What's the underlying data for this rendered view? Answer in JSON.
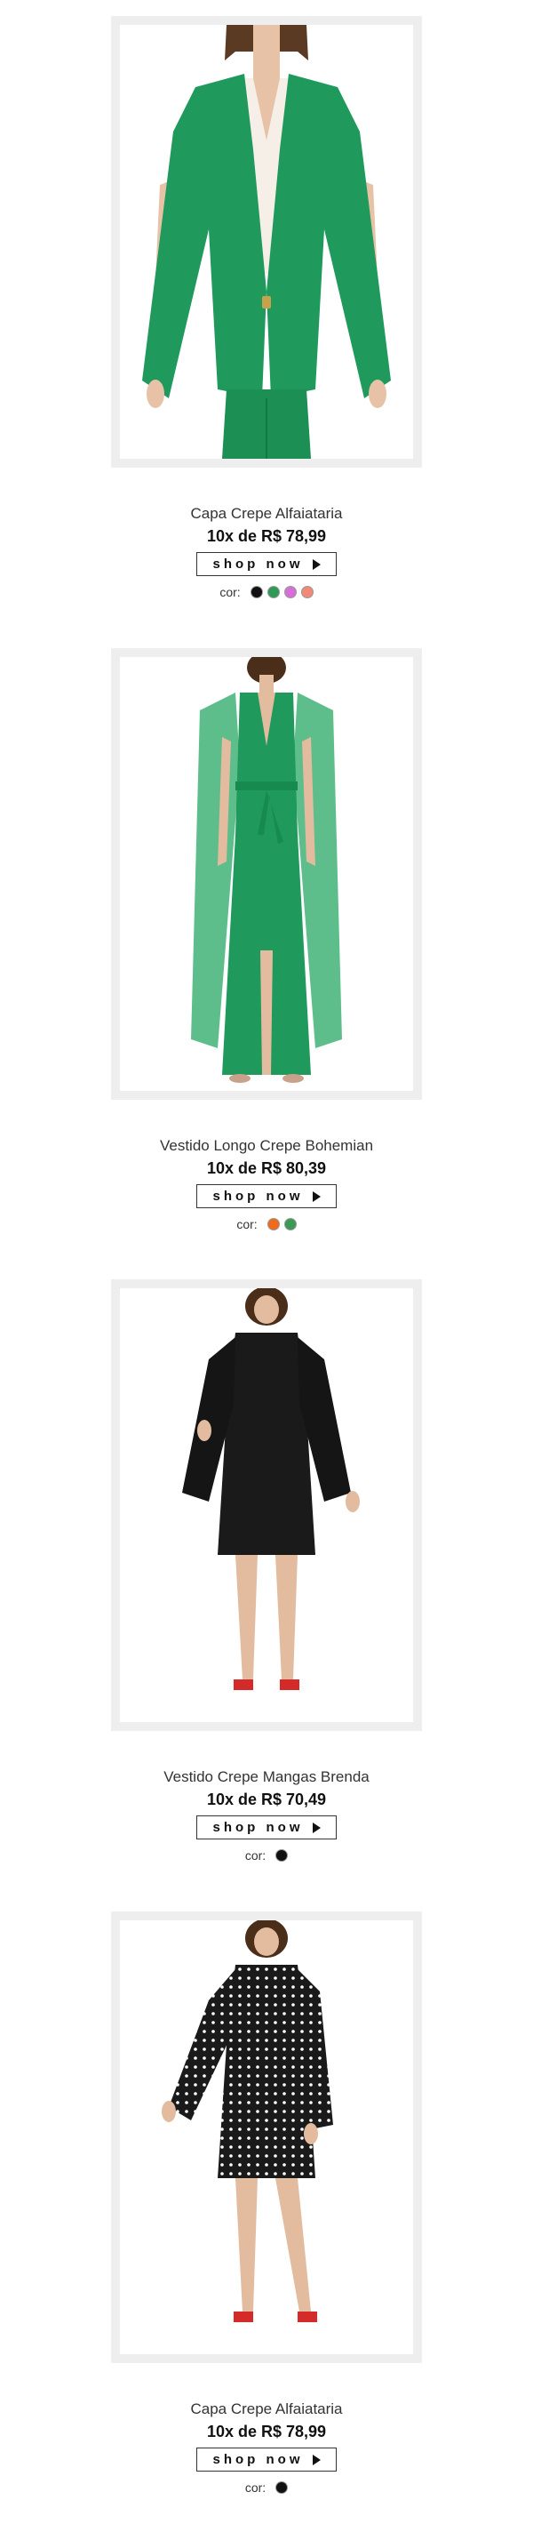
{
  "products": [
    {
      "name": "Capa Crepe Alfaiataria",
      "price": "10x de R$  78,99",
      "shop_label": "shop now",
      "color_label": "cor:",
      "image_alt": "green-cape-blazer",
      "colors": [
        "#111111",
        "#2e9a55",
        "#d66fd6",
        "#f08a78"
      ]
    },
    {
      "name": "Vestido Longo Crepe Bohemian",
      "price": "10x de R$  80,39",
      "shop_label": "shop now",
      "color_label": "cor:",
      "image_alt": "green-long-dress",
      "colors": [
        "#ee6a1c",
        "#3a9a55"
      ]
    },
    {
      "name": "Vestido Crepe Mangas Brenda",
      "price": "10x de R$  70,49",
      "shop_label": "shop now",
      "color_label": "cor:",
      "image_alt": "black-cape-sleeve-dress",
      "colors": [
        "#111111"
      ]
    },
    {
      "name": "Capa Crepe Alfaiataria",
      "price": "10x de R$  78,99",
      "shop_label": "shop now",
      "color_label": "cor:",
      "image_alt": "polka-dot-dress",
      "colors": [
        "#111111"
      ]
    }
  ]
}
